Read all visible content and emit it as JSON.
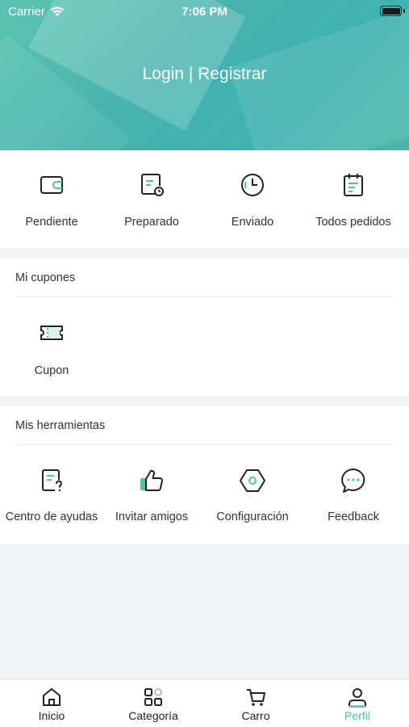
{
  "status_bar": {
    "carrier": "Carrier",
    "time": "7:06 PM"
  },
  "header": {
    "login": "Login",
    "separator": "|",
    "register": "Registrar"
  },
  "orders": [
    {
      "label": "Pendiente",
      "icon": "wallet-icon"
    },
    {
      "label": "Preparado",
      "icon": "order-clock-icon"
    },
    {
      "label": "Enviado",
      "icon": "clock-icon"
    },
    {
      "label": "Todos pedidos",
      "icon": "calendar-list-icon"
    }
  ],
  "coupons": {
    "title": "Mi cupones",
    "items": [
      {
        "label": "Cupon",
        "icon": "ticket-icon"
      }
    ]
  },
  "tools": {
    "title": "Mis herramientas",
    "items": [
      {
        "label": "Centro de ayudas",
        "icon": "help-document-icon"
      },
      {
        "label": "Invitar amigos",
        "icon": "thumbs-up-icon"
      },
      {
        "label": "Configuración",
        "icon": "hexagon-settings-icon"
      },
      {
        "label": "Feedback",
        "icon": "chat-bubble-icon"
      }
    ]
  },
  "tabbar": {
    "active": "Perfil",
    "items": [
      {
        "label": "Inicio",
        "icon": "home-icon"
      },
      {
        "label": "Categoría",
        "icon": "category-grid-icon"
      },
      {
        "label": "Carro",
        "icon": "cart-icon"
      },
      {
        "label": "Perfil",
        "icon": "user-icon"
      }
    ]
  },
  "colors": {
    "accent": "#4fc4a5",
    "header_gradient_start": "#5cc4b3",
    "header_gradient_end": "#3fb3b2",
    "background": "#f2f3f5"
  }
}
